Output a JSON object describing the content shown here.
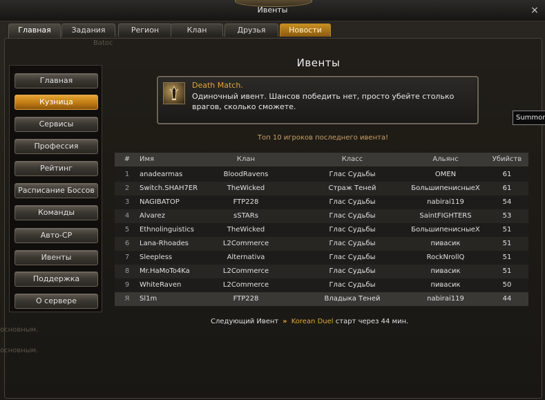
{
  "window": {
    "title": "Ивенты",
    "close_label": "×"
  },
  "tabs": [
    {
      "label": "Главная"
    },
    {
      "label": "Задания"
    },
    {
      "label": "Регион"
    },
    {
      "label": "Клан"
    },
    {
      "label": "Друзья"
    },
    {
      "label": "Новости"
    }
  ],
  "background": {
    "text1": "Batoc",
    "text2": "основным.",
    "text3": "основным."
  },
  "sidebar": {
    "items": [
      {
        "label": "Главная"
      },
      {
        "label": "Кузница"
      },
      {
        "label": "Сервисы"
      },
      {
        "label": "Профессия"
      },
      {
        "label": "Рейтинг"
      },
      {
        "label": "Расписание Боссов"
      },
      {
        "label": "Команды"
      },
      {
        "label": "Авто-СР"
      },
      {
        "label": "Ивенты"
      },
      {
        "label": "Поддержка"
      },
      {
        "label": "О сервере"
      }
    ],
    "active_index": 1
  },
  "main": {
    "title": "Ивенты",
    "event": {
      "name": "Death Match.",
      "description": "Одиночный ивент. Шансов победить нет, просто убейте столько врагов, сколько сможете.",
      "icon": "trophy-icon"
    },
    "top_title": "Топ 10 игроков последнего ивента!",
    "table": {
      "headers": {
        "num": "#",
        "name": "Имя",
        "clan": "Клан",
        "class": "Класс",
        "ally": "Альянс",
        "kills": "Убийств"
      },
      "rows": [
        {
          "num": "1",
          "name": "anadearmas",
          "clan": "BloodRavens",
          "class": "Глас Судьбы",
          "ally": "OMEN",
          "kills": "61"
        },
        {
          "num": "2",
          "name": "Switch.SHAH7ER",
          "clan": "TheWicked",
          "class": "Страж Теней",
          "ally": "БольшипенисныеХ",
          "kills": "61"
        },
        {
          "num": "3",
          "name": "NAGIBATOP",
          "clan": "FTP228",
          "class": "Глас Судьбы",
          "ally": "nabirai119",
          "kills": "54"
        },
        {
          "num": "4",
          "name": "Alvarez",
          "clan": "sSTARs",
          "class": "Глас Судьбы",
          "ally": "SaintFIGHTERS",
          "kills": "53"
        },
        {
          "num": "5",
          "name": "Ethnolinguistics",
          "clan": "TheWicked",
          "class": "Глас Судьбы",
          "ally": "БольшипенисныеХ",
          "kills": "51"
        },
        {
          "num": "6",
          "name": "Lana-Rhoades",
          "clan": "L2Commerce",
          "class": "Глас Судьбы",
          "ally": "пивасик",
          "kills": "51"
        },
        {
          "num": "7",
          "name": "Sleepless",
          "clan": "Alternativa",
          "class": "Глас Судьбы",
          "ally": "RockNrollQ",
          "kills": "51"
        },
        {
          "num": "8",
          "name": "Mr.HaMoTo4Ka",
          "clan": "L2Commerce",
          "class": "Глас Судьбы",
          "ally": "пивасик",
          "kills": "51"
        },
        {
          "num": "9",
          "name": "WhiteRaven",
          "clan": "L2Commerce",
          "class": "Глас Судьбы",
          "ally": "пивасик",
          "kills": "50"
        },
        {
          "num": "Я",
          "name": "Sl1m",
          "clan": "FTP228",
          "class": "Владыка Теней",
          "ally": "nabirai119",
          "kills": "44"
        }
      ]
    },
    "next": {
      "label": "Следующий Ивент",
      "arrow": "»",
      "event_name": "Korean Duel",
      "suffix": "старт через 44 мин."
    }
  },
  "popup": {
    "summon_label": "Summon"
  },
  "colors": {
    "accent": "#e0a53a",
    "active_button": "#c07b14",
    "news_tab": "#c88e22"
  }
}
